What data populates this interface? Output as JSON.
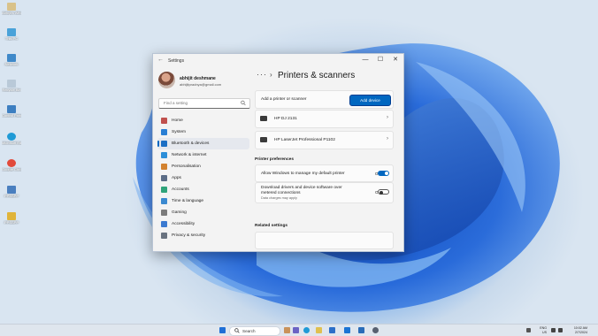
{
  "desktop": {
    "icons": [
      {
        "label": "Abhijit's Windows",
        "color": "#d9c28a"
      },
      {
        "label": "This PC",
        "color": "#4aa2d9"
      },
      {
        "label": "Network",
        "color": "#3f89c9"
      },
      {
        "label": "Recycle Bin",
        "color": "#b9c9d8"
      },
      {
        "label": "Control Panel",
        "color": "#3d7fc1"
      },
      {
        "label": "Microsoft Edge",
        "color": "#1f9ad6"
      },
      {
        "label": "Google Chrome",
        "color": "#e24a3b"
      },
      {
        "label": "PPSSPP",
        "color": "#4a7fbf"
      },
      {
        "label": "PPSSPP",
        "color": "#e0b43a"
      }
    ]
  },
  "window": {
    "title": "Settings",
    "back_icon": "back-arrow-icon",
    "controls": {
      "minimize": "—",
      "maximize": "☐",
      "close": "✕"
    }
  },
  "user": {
    "name": "abhijit deshmane",
    "email": "abhijitpradnya@gmail.com"
  },
  "search": {
    "placeholder": "Find a setting",
    "icon": "search-icon"
  },
  "nav": {
    "items": [
      {
        "label": "Home",
        "icon": "home-icon",
        "color": "#c0504d"
      },
      {
        "label": "System",
        "icon": "monitor-icon",
        "color": "#2a7fd4"
      },
      {
        "label": "Bluetooth & devices",
        "icon": "bluetooth-icon",
        "color": "#1c6fc4",
        "selected": true
      },
      {
        "label": "Network & internet",
        "icon": "wifi-icon",
        "color": "#2d8fd8"
      },
      {
        "label": "Personalisation",
        "icon": "brush-icon",
        "color": "#d2822f"
      },
      {
        "label": "Apps",
        "icon": "apps-icon",
        "color": "#5b6c86"
      },
      {
        "label": "Accounts",
        "icon": "person-icon",
        "color": "#2fa37a"
      },
      {
        "label": "Time & language",
        "icon": "globe-clock-icon",
        "color": "#3a89d0"
      },
      {
        "label": "Gaming",
        "icon": "gamepad-icon",
        "color": "#7b7b7b"
      },
      {
        "label": "Accessibility",
        "icon": "accessibility-icon",
        "color": "#3b7ad0"
      },
      {
        "label": "Privacy & security",
        "icon": "shield-icon",
        "color": "#6a7380"
      }
    ]
  },
  "main": {
    "breadcrumb_dots": "···",
    "breadcrumb_sep": "›",
    "title": "Printers & scanners",
    "add_card": {
      "label": "Add a printer or scanner",
      "button": "Add device"
    },
    "printers": [
      {
        "name": "HP DJ 2131",
        "icon": "printer-icon"
      },
      {
        "name": "HP LaserJet Professional P1102",
        "icon": "printer-icon"
      }
    ],
    "prefs_header": "Printer preferences",
    "prefs": [
      {
        "label": "Allow Windows to manage my default printer",
        "sub": "",
        "state": "On",
        "on": true
      },
      {
        "label": "Download drivers and device software over metered connections",
        "sub": "Data charges may apply",
        "state": "Off",
        "on": false
      }
    ],
    "related_header": "Related settings"
  },
  "taskbar": {
    "search_label": "Search",
    "tray_lang": "ENG",
    "tray_region": "US",
    "time": "10:02 AM",
    "date": "2/7/2024",
    "icons": [
      "start-icon",
      "search-icon",
      "widgets-icon",
      "chat-icon",
      "edge-icon",
      "file-explorer-icon",
      "store-icon",
      "mail-icon",
      "settings-icon"
    ]
  },
  "colors": {
    "accent": "#0067c0",
    "window_bg": "#f3f3f3",
    "card_bg": "#fbfbfb"
  }
}
